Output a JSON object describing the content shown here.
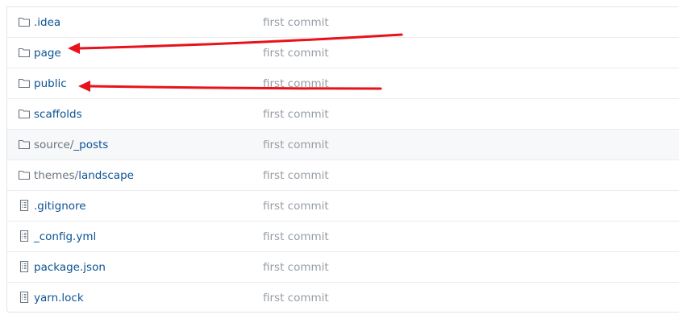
{
  "files": [
    {
      "prefix": "",
      "name": ".idea",
      "message": "first commit",
      "icon": "folder-icon",
      "highlight": false
    },
    {
      "prefix": "",
      "name": "page",
      "message": "first commit",
      "icon": "folder-icon",
      "highlight": false
    },
    {
      "prefix": "",
      "name": "public",
      "message": "first commit",
      "icon": "folder-icon",
      "highlight": false
    },
    {
      "prefix": "",
      "name": "scaffolds",
      "message": "first commit",
      "icon": "folder-icon",
      "highlight": false
    },
    {
      "prefix": "source/",
      "name": "_posts",
      "message": "first commit",
      "icon": "folder-icon",
      "highlight": true
    },
    {
      "prefix": "themes/",
      "name": "landscape",
      "message": "first commit",
      "icon": "folder-icon",
      "highlight": false
    },
    {
      "prefix": "",
      "name": ".gitignore",
      "message": "first commit",
      "icon": "file-icon",
      "highlight": false
    },
    {
      "prefix": "",
      "name": "_config.yml",
      "message": "first commit",
      "icon": "file-icon",
      "highlight": false
    },
    {
      "prefix": "",
      "name": "package.json",
      "message": "first commit",
      "icon": "file-icon",
      "highlight": false
    },
    {
      "prefix": "",
      "name": "yarn.lock",
      "message": "first commit",
      "icon": "file-icon",
      "highlight": false
    }
  ],
  "colors": {
    "link": "#0b5394",
    "muted": "#959da5",
    "annotation_arrow": "#e8121b"
  }
}
